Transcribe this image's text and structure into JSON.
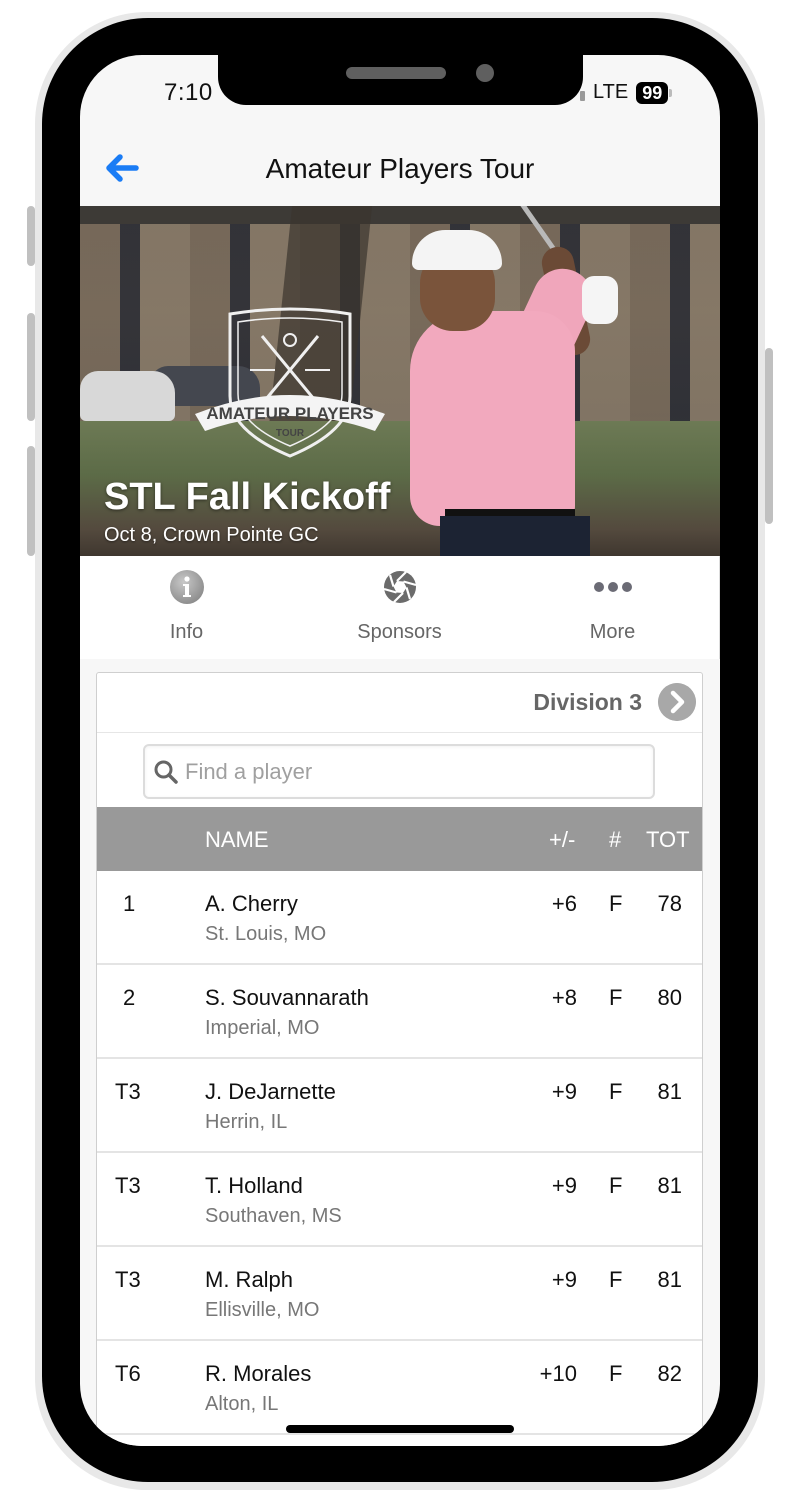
{
  "status_bar": {
    "time": "7:10",
    "network": "LTE",
    "battery": "99"
  },
  "nav": {
    "back_icon": "back-arrow-icon",
    "title": "Amateur Players Tour"
  },
  "hero": {
    "logo_line1": "AMATEUR PLAYERS",
    "logo_line2": "TOUR",
    "event_title": "STL Fall Kickoff",
    "event_subtitle": "Oct 8, Crown Pointe GC"
  },
  "tabs": [
    {
      "label": "Info",
      "icon": "info-icon"
    },
    {
      "label": "Sponsors",
      "icon": "aperture-icon"
    },
    {
      "label": "More",
      "icon": "more-dots-icon"
    }
  ],
  "leaderboard": {
    "division": "Division 3",
    "search": {
      "placeholder": "Find a player",
      "value": ""
    },
    "columns": {
      "pos": "",
      "name": "NAME",
      "plus_minus": "+/-",
      "hole": "#",
      "total": "TOT"
    },
    "rows": [
      {
        "pos": "1",
        "name": "A. Cherry",
        "location": "St. Louis, MO",
        "plus_minus": "+6",
        "hole": "F",
        "total": "78"
      },
      {
        "pos": "2",
        "name": "S. Souvannarath",
        "location": "Imperial, MO",
        "plus_minus": "+8",
        "hole": "F",
        "total": "80"
      },
      {
        "pos": "T3",
        "name": "J. DeJarnette",
        "location": "Herrin, IL",
        "plus_minus": "+9",
        "hole": "F",
        "total": "81"
      },
      {
        "pos": "T3",
        "name": "T. Holland",
        "location": "Southaven, MS",
        "plus_minus": "+9",
        "hole": "F",
        "total": "81"
      },
      {
        "pos": "T3",
        "name": "M. Ralph",
        "location": "Ellisville, MO",
        "plus_minus": "+9",
        "hole": "F",
        "total": "81"
      },
      {
        "pos": "T6",
        "name": "R. Morales",
        "location": "Alton, IL",
        "plus_minus": "+10",
        "hole": "F",
        "total": "82"
      }
    ]
  },
  "colors": {
    "accent_blue": "#1a7cf5",
    "header_gray": "#999999",
    "shirt_pink": "#f2a9be"
  }
}
